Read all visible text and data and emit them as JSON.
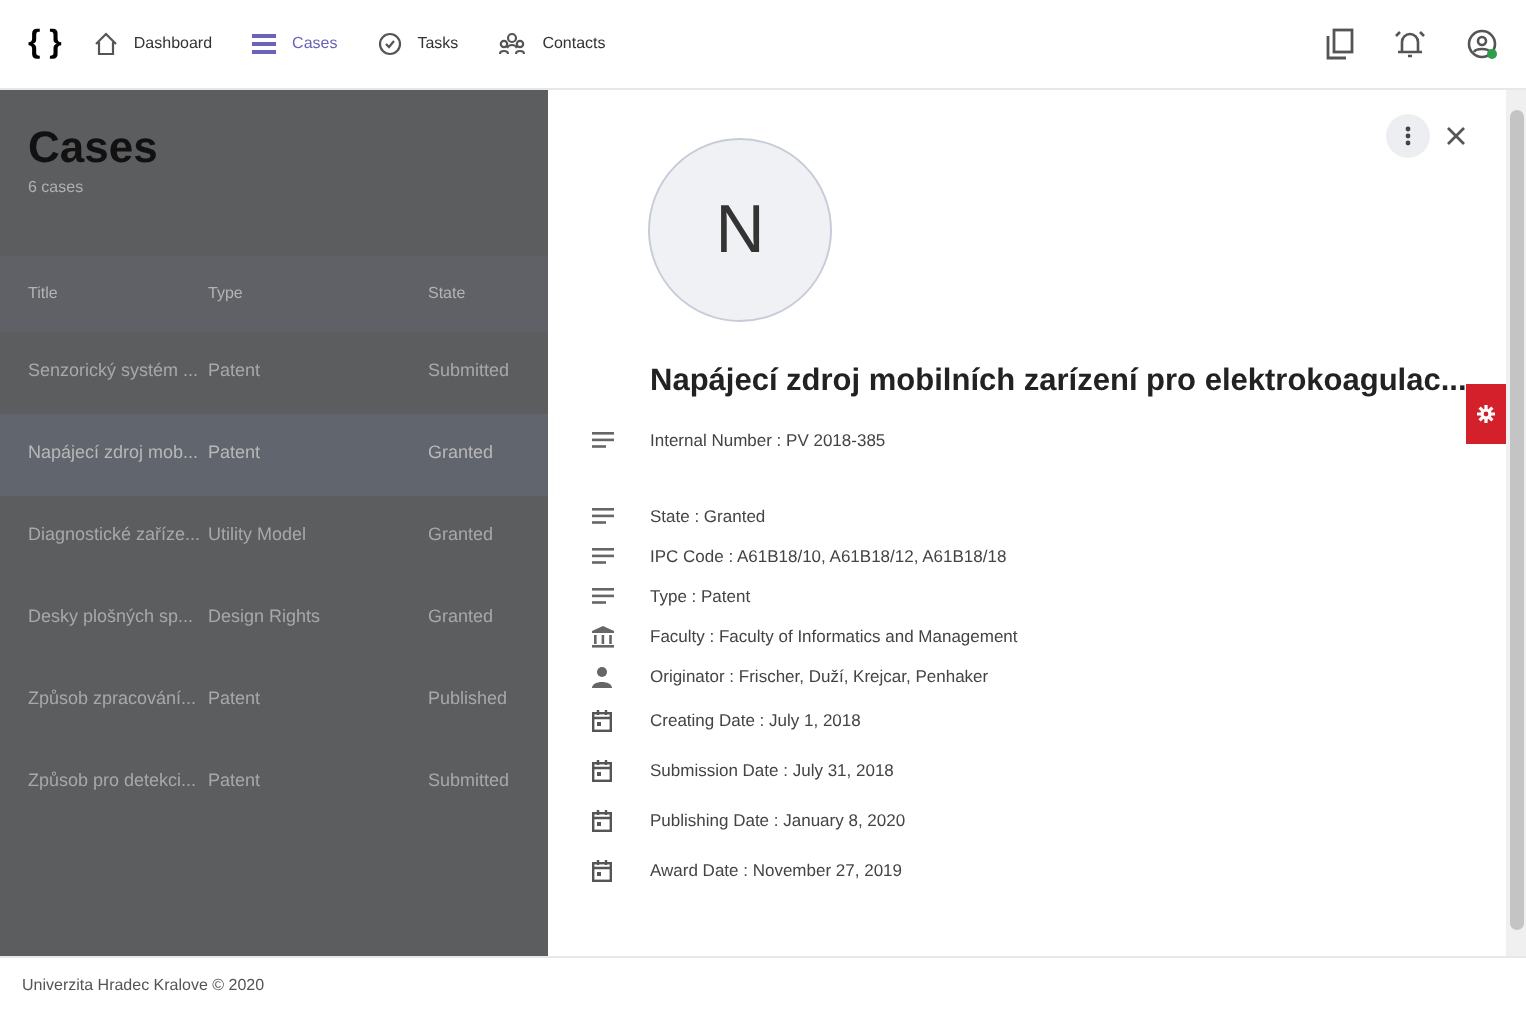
{
  "logo": "{ }",
  "nav": [
    {
      "label": "Dashboard",
      "kind": "home",
      "selected": false
    },
    {
      "label": "Cases",
      "kind": "list",
      "selected": true
    },
    {
      "label": "Tasks",
      "kind": "check",
      "selected": false
    },
    {
      "label": "Contacts",
      "kind": "people",
      "selected": false
    }
  ],
  "cases": {
    "title": "Cases",
    "count": "6 cases",
    "columns": [
      "Title",
      "Type",
      "State"
    ],
    "rows": [
      {
        "title": "Senzorický systém ...",
        "type": "Patent",
        "state": "Submitted",
        "selected": false
      },
      {
        "title": "Napájecí zdroj mob...",
        "type": "Patent",
        "state": "Granted",
        "selected": true
      },
      {
        "title": "Diagnostické zaříze...",
        "type": "Utility Model",
        "state": "Granted",
        "selected": false
      },
      {
        "title": "Desky plošných sp...",
        "type": "Design Rights",
        "state": "Granted",
        "selected": false
      },
      {
        "title": "Způsob zpracování...",
        "type": "Patent",
        "state": "Published",
        "selected": false
      },
      {
        "title": "Způsob pro detekci...",
        "type": "Patent",
        "state": "Submitted",
        "selected": false
      }
    ]
  },
  "detail": {
    "avatar": "N",
    "title": "Napájecí zdroj mobilních zarízení pro elektrokoagulac...",
    "fields": [
      {
        "kind": "text",
        "text": "Internal Number : PV 2018-385"
      },
      {
        "kind": "text",
        "text": "State : Granted"
      },
      {
        "kind": "text",
        "text": "IPC Code : A61B18/10, A61B18/12, A61B18/18"
      },
      {
        "kind": "text",
        "text": "Type : Patent"
      },
      {
        "kind": "faculty",
        "text": "Faculty : Faculty of Informatics and Management"
      },
      {
        "kind": "person",
        "text": "Originator : Frischer, Duží, Krejcar, Penhaker"
      },
      {
        "kind": "date",
        "text": "Creating Date : July 1, 2018"
      },
      {
        "kind": "date",
        "text": "Submission Date : July 31, 2018"
      },
      {
        "kind": "date",
        "text": "Publishing Date : January 8, 2020"
      },
      {
        "kind": "date",
        "text": "Award Date : November 27, 2019"
      }
    ]
  },
  "footer": "Univerzita Hradec Kralove © 2020"
}
